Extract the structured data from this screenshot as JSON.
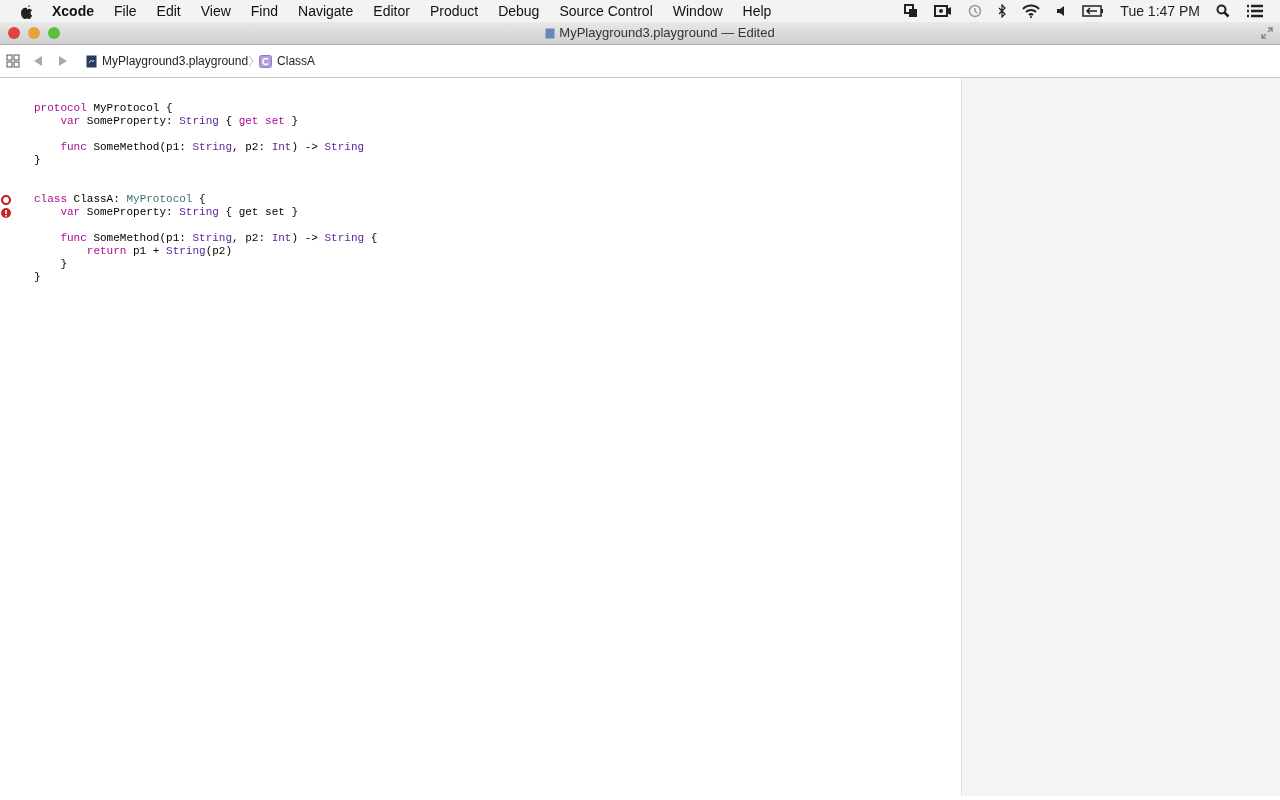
{
  "menu_bar": {
    "app": "Xcode",
    "items": [
      "File",
      "Edit",
      "View",
      "Find",
      "Navigate",
      "Editor",
      "Product",
      "Debug",
      "Source Control",
      "Window",
      "Help"
    ],
    "clock": "Tue 1:47 PM"
  },
  "window": {
    "title": "MyPlayground3.playground — Edited"
  },
  "jump_bar": {
    "items": [
      {
        "label": "MyPlayground3.playground",
        "kind": "file"
      },
      {
        "label": "ClassA",
        "kind": "class"
      }
    ]
  },
  "editor": {
    "lines": [
      {
        "kind": "code",
        "tokens": [
          {
            "text": "protocol",
            "kind": "keyword"
          },
          {
            "text": " MyProtocol {",
            "kind": "plain"
          }
        ]
      },
      {
        "kind": "code",
        "tokens": [
          {
            "text": "    var",
            "kind": "keyword"
          },
          {
            "text": " SomeProperty: ",
            "kind": "plain"
          },
          {
            "text": "String",
            "kind": "type"
          },
          {
            "text": " { ",
            "kind": "plain"
          },
          {
            "text": "get set",
            "kind": "keyword"
          },
          {
            "text": " }",
            "kind": "plain"
          }
        ]
      },
      {
        "kind": "blank"
      },
      {
        "kind": "code",
        "tokens": [
          {
            "text": "    func",
            "kind": "keyword"
          },
          {
            "text": " SomeMethod(p1: ",
            "kind": "plain"
          },
          {
            "text": "String",
            "kind": "type"
          },
          {
            "text": ", p2: ",
            "kind": "plain"
          },
          {
            "text": "Int",
            "kind": "type"
          },
          {
            "text": ") -> ",
            "kind": "plain"
          },
          {
            "text": "String",
            "kind": "type"
          }
        ]
      },
      {
        "kind": "code",
        "tokens": [
          {
            "text": "}",
            "kind": "plain"
          }
        ]
      },
      {
        "kind": "blank"
      },
      {
        "kind": "blank"
      },
      {
        "kind": "error-ring",
        "tokens": [
          {
            "text": "class",
            "kind": "keyword"
          },
          {
            "text": " ClassA: ",
            "kind": "plain"
          },
          {
            "text": "MyProtocol",
            "kind": "project"
          },
          {
            "text": " {",
            "kind": "plain"
          }
        ]
      },
      {
        "kind": "error",
        "tokens": [
          {
            "text": "    var",
            "kind": "keyword"
          },
          {
            "text": " SomeProperty: ",
            "kind": "plain"
          },
          {
            "text": "String",
            "kind": "type"
          },
          {
            "text": " { get set }",
            "kind": "plain"
          }
        ]
      },
      {
        "kind": "blank"
      },
      {
        "kind": "code",
        "tokens": [
          {
            "text": "    func",
            "kind": "keyword"
          },
          {
            "text": " SomeMethod(p1: ",
            "kind": "plain"
          },
          {
            "text": "String",
            "kind": "type"
          },
          {
            "text": ", p2: ",
            "kind": "plain"
          },
          {
            "text": "Int",
            "kind": "type"
          },
          {
            "text": ") -> ",
            "kind": "plain"
          },
          {
            "text": "String",
            "kind": "type"
          },
          {
            "text": " {",
            "kind": "plain"
          }
        ]
      },
      {
        "kind": "code",
        "tokens": [
          {
            "text": "        return",
            "kind": "keyword"
          },
          {
            "text": " p1 + ",
            "kind": "plain"
          },
          {
            "text": "String",
            "kind": "type"
          },
          {
            "text": "(p2)",
            "kind": "plain"
          }
        ]
      },
      {
        "kind": "code",
        "tokens": [
          {
            "text": "    }",
            "kind": "plain"
          }
        ]
      },
      {
        "kind": "code",
        "tokens": [
          {
            "text": "}",
            "kind": "plain"
          }
        ]
      }
    ]
  }
}
